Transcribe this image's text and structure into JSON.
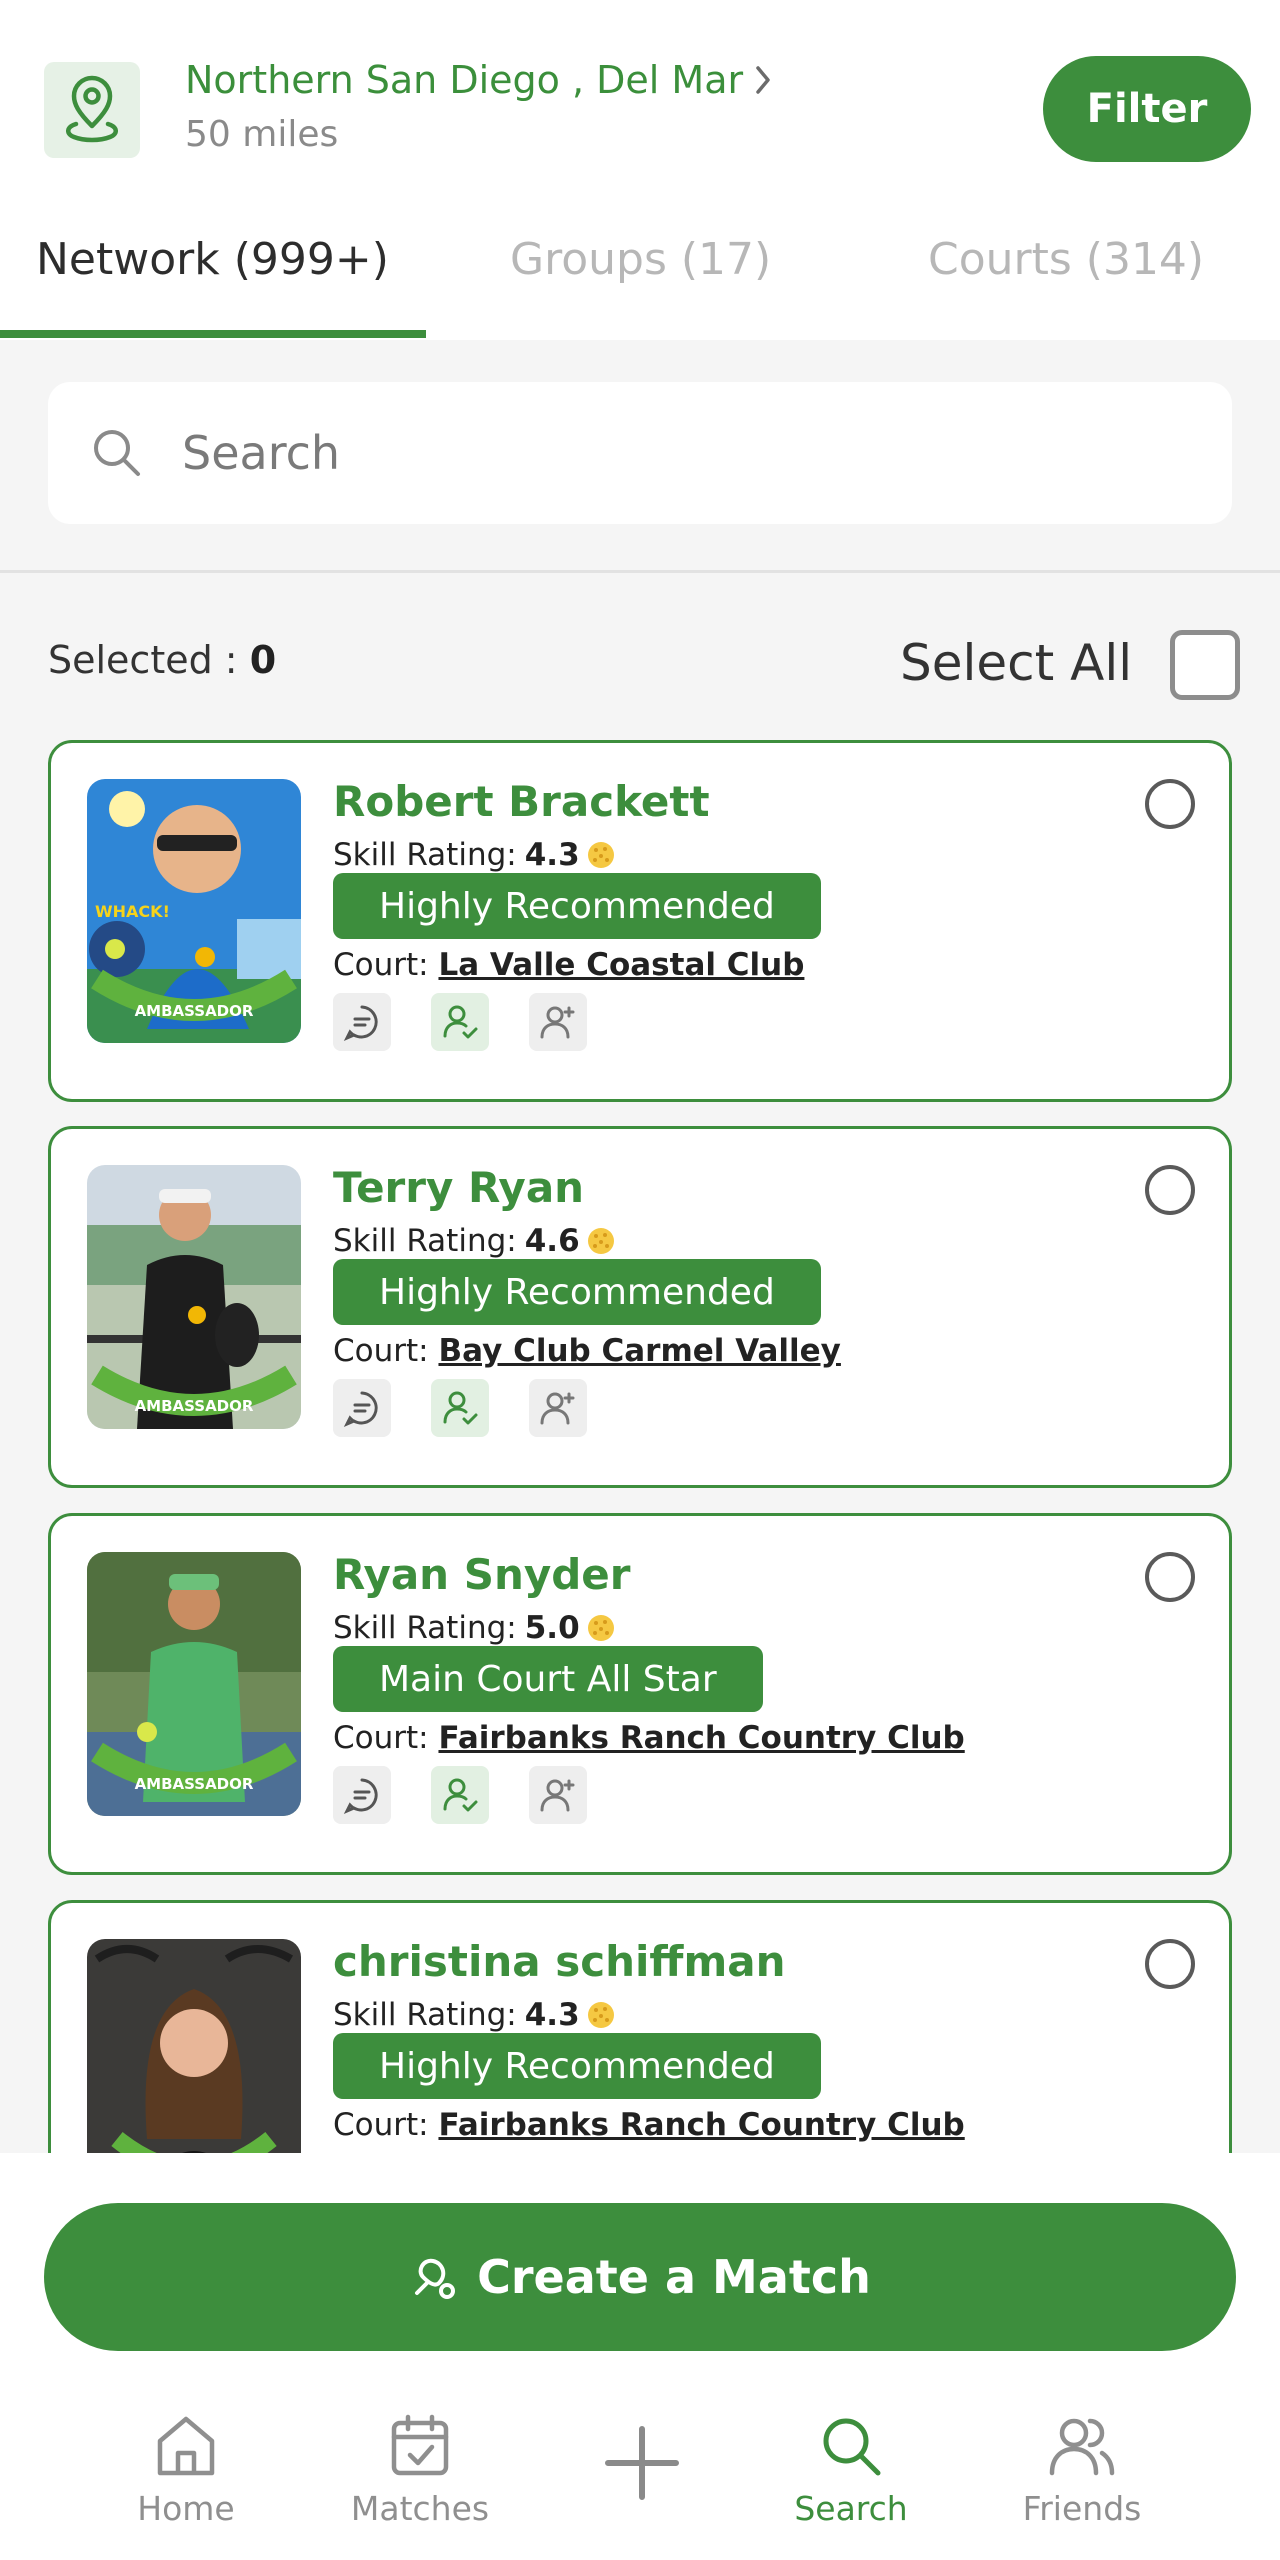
{
  "header": {
    "location_title": "Northern San Diego , Del Mar",
    "radius": "50 miles",
    "filter_label": "Filter"
  },
  "tabs": [
    {
      "label": "Network (999+)",
      "active": true
    },
    {
      "label": "Groups (17)",
      "active": false
    },
    {
      "label": "Courts (314)",
      "active": false
    }
  ],
  "search": {
    "placeholder": "Search",
    "value": ""
  },
  "selection": {
    "selected_label": "Selected :",
    "selected_count": "0",
    "select_all_label": "Select All"
  },
  "players": [
    {
      "name": "Robert Brackett",
      "skill_label": "Skill Rating:",
      "skill": "4.3",
      "badge": "Highly Recommended",
      "court_label": "Court:",
      "court": "La Valle Coastal Club"
    },
    {
      "name": "Terry Ryan",
      "skill_label": "Skill Rating:",
      "skill": "4.6",
      "badge": "Highly Recommended",
      "court_label": "Court:",
      "court": "Bay Club Carmel Valley"
    },
    {
      "name": "Ryan Snyder",
      "skill_label": "Skill Rating:",
      "skill": "5.0",
      "badge": "Main Court All Star",
      "court_label": "Court:",
      "court": "Fairbanks Ranch Country Club"
    },
    {
      "name": "christina schiffman",
      "skill_label": "Skill Rating:",
      "skill": "4.3",
      "badge": "Highly Recommended",
      "court_label": "Court:",
      "court": "Fairbanks Ranch Country Club"
    }
  ],
  "avatar_overlays": {
    "ambassador": "AMBASSADOR",
    "whack": "WHACK!"
  },
  "create_match_label": "Create a Match",
  "nav": [
    {
      "label": "Home",
      "icon": "home-icon"
    },
    {
      "label": "Matches",
      "icon": "calendar-check-icon"
    },
    {
      "label": "",
      "icon": "plus-icon"
    },
    {
      "label": "Search",
      "icon": "search-icon",
      "active": true
    },
    {
      "label": "Friends",
      "icon": "friends-icon"
    }
  ],
  "colors": {
    "brand_green": "#3d8e3d",
    "light_green": "#e6f1e6",
    "inactive_gray": "#b7b7b7"
  }
}
